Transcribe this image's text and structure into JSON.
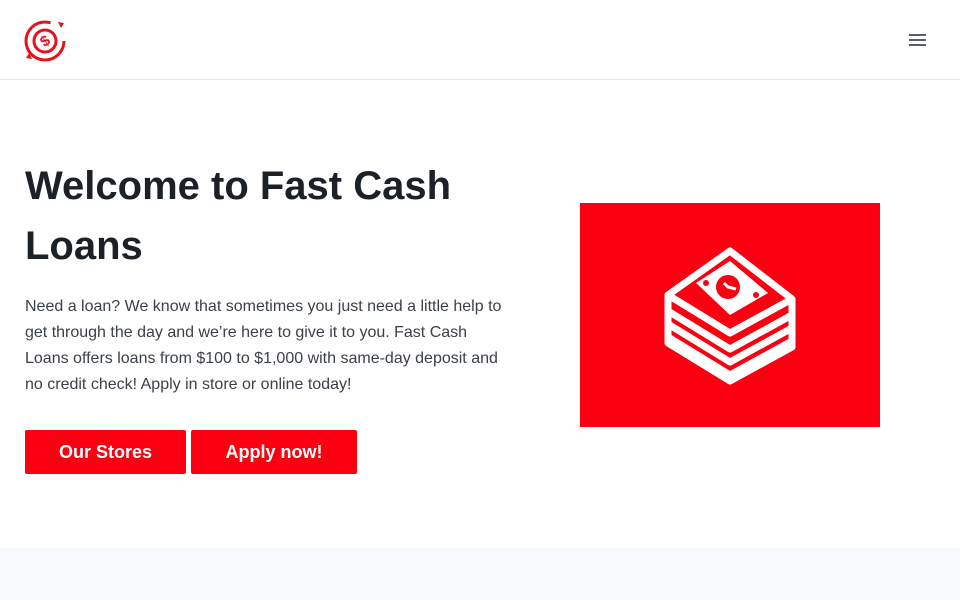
{
  "header": {
    "logo_icon": "dollar-circle-arrows-icon",
    "menu_icon": "hamburger-menu-icon"
  },
  "hero": {
    "title": "Welcome to Fast Cash Loans",
    "description": "Need a loan? We know that sometimes you just need a little help to get through the day and we’re here to give it to you. Fast Cash Loans offers loans from $100 to $1,000 with same-day deposit and no credit check! Apply in store or online today!",
    "buttons": {
      "stores_label": "Our Stores",
      "apply_label": "Apply now!"
    },
    "image_icon": "money-stack-icon"
  },
  "colors": {
    "accent": "#fa0010",
    "text": "#1c2127",
    "body_text": "#3b4148",
    "band": "#f7f9fb"
  }
}
